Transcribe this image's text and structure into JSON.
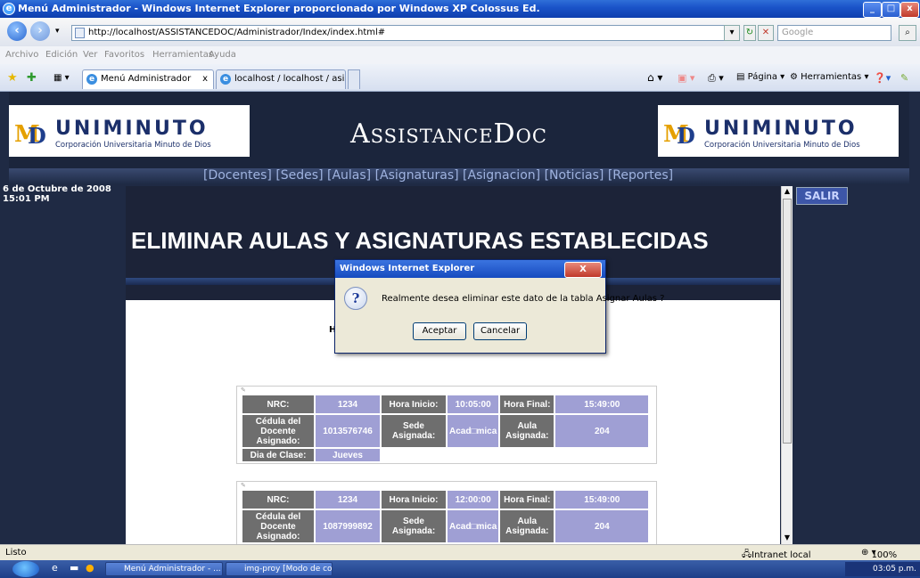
{
  "window": {
    "title": "Menú Administrador - Windows Internet Explorer proporcionado por Windows XP Colossus Ed."
  },
  "address": {
    "url": "http://localhost/ASSISTANCEDOC/Administrador/Index/index.html#",
    "search_placeholder": "Google"
  },
  "menu": [
    "Archivo",
    "Edición",
    "Ver",
    "Favoritos",
    "Herramientas",
    "Ayuda"
  ],
  "tabs": [
    {
      "label": "Menú Administrador",
      "close": "x"
    },
    {
      "label": "localhost / localhost / asisten..."
    }
  ],
  "commandbar": {
    "page": "Página",
    "tools": "Herramientas"
  },
  "site": {
    "logo_name": "UNIMINUTO",
    "logo_sub": "Corporación Universitaria Minuto de Dios",
    "app_title": "AssistanceDoc",
    "nav": [
      "[Docentes]",
      "[Sedes]",
      "[Aulas]",
      "[Asignaturas]",
      "[Asignacion]",
      "[Noticias]",
      "[Reportes]"
    ],
    "date": "6 de Octubre de 2008",
    "time": "15:01 PM",
    "logout": "SALIR",
    "heading": "ELIMINAR AULAS Y ASIGNATURAS ESTABLECIDAS",
    "partial_label": "Ha"
  },
  "labels": {
    "nrc": "NRC:",
    "hora_inicio": "Hora Inicio:",
    "hora_final": "Hora Final:",
    "cedula": "Cédula del Docente Asignado:",
    "sede": "Sede Asignada:",
    "aula": "Aula Asignada:",
    "dia": "Dia de Clase:"
  },
  "records": [
    {
      "nrc": "1234",
      "hora_inicio": "10:05:00",
      "hora_final": "15:49:00",
      "cedula": "1013576746",
      "sede": "Acad□mica",
      "aula": "204",
      "dia": "Jueves"
    },
    {
      "nrc": "1234",
      "hora_inicio": "12:00:00",
      "hora_final": "15:49:00",
      "cedula": "1087999892",
      "sede": "Acad□mica",
      "aula": "204"
    }
  ],
  "dialog": {
    "title": "Windows Internet Explorer",
    "message": "Realmente desea eliminar este dato de la tabla Asignar Aulas ?",
    "ok": "Aceptar",
    "cancel": "Cancelar",
    "icon": "question-icon"
  },
  "status": {
    "text": "Listo",
    "zone": "Intranet local",
    "zoom": "100%"
  },
  "taskbar": {
    "tasks": [
      "Menú Administrador - ...",
      "img-proy [Modo de co..."
    ],
    "clock": "03:05 p.m."
  }
}
